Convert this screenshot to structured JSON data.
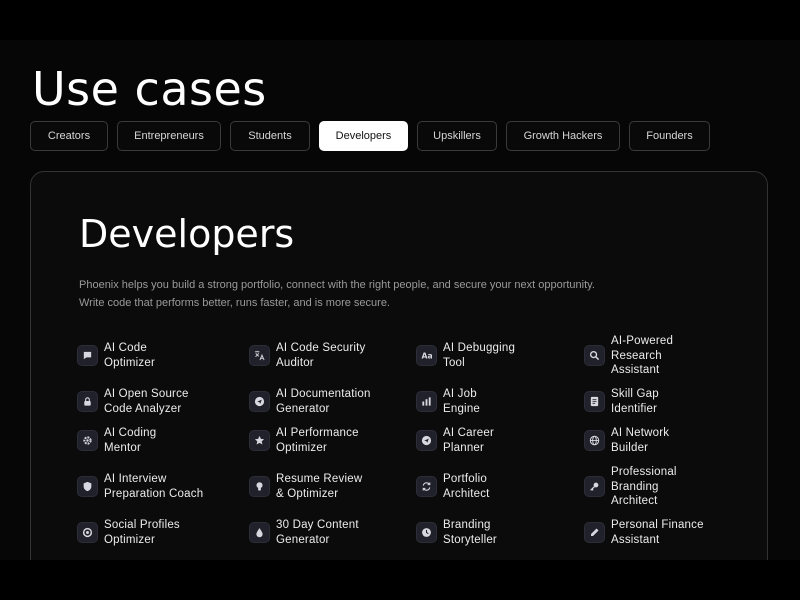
{
  "header": {
    "title": "Use cases"
  },
  "tabs": [
    {
      "label": "Creators",
      "active": false
    },
    {
      "label": "Entrepreneurs",
      "active": false
    },
    {
      "label": "Students",
      "active": false
    },
    {
      "label": "Developers",
      "active": true
    },
    {
      "label": "Upskillers",
      "active": false
    },
    {
      "label": "Growth Hackers",
      "active": false
    },
    {
      "label": "Founders",
      "active": false
    }
  ],
  "panel": {
    "title": "Developers",
    "description_line1": "Phoenix helps you build a strong portfolio, connect with the right people, and secure your next opportunity.",
    "description_line2": "Write code that performs better, runs faster, and is more secure."
  },
  "tools": [
    {
      "label": "AI Code\nOptimizer",
      "icon": "chat-icon"
    },
    {
      "label": "AI Code Security\nAuditor",
      "icon": "translate-icon"
    },
    {
      "label": "AI Debugging\nTool",
      "icon": "font-icon"
    },
    {
      "label": "AI-Powered\nResearch\nAssistant",
      "icon": "search-icon"
    },
    {
      "label": "AI Open Source\nCode Analyzer",
      "icon": "lock-icon"
    },
    {
      "label": "AI Documentation\nGenerator",
      "icon": "send-icon"
    },
    {
      "label": "AI Job\nEngine",
      "icon": "bar-chart-icon"
    },
    {
      "label": "Skill Gap\nIdentifier",
      "icon": "document-icon"
    },
    {
      "label": "AI Coding\nMentor",
      "icon": "gear-icon"
    },
    {
      "label": "AI Performance\nOptimizer",
      "icon": "star-icon"
    },
    {
      "label": "AI Career\nPlanner",
      "icon": "send-icon"
    },
    {
      "label": "AI Network\nBuilder",
      "icon": "globe-icon"
    },
    {
      "label": "AI Interview\nPreparation Coach",
      "icon": "shield-icon"
    },
    {
      "label": "Resume Review\n& Optimizer",
      "icon": "lightbulb-icon"
    },
    {
      "label": "Portfolio\nArchitect",
      "icon": "refresh-icon"
    },
    {
      "label": "Professional\nBranding\nArchitect",
      "icon": "key-icon"
    },
    {
      "label": "Social Profiles\nOptimizer",
      "icon": "target-icon"
    },
    {
      "label": "30 Day Content\nGenerator",
      "icon": "drop-icon"
    },
    {
      "label": "Branding\nStoryteller",
      "icon": "clock-icon"
    },
    {
      "label": "Personal Finance\nAssistant",
      "icon": "pencil-icon"
    }
  ],
  "colors": {
    "background": "#000000",
    "active_tab": "#ffffff",
    "icon_bg": "#20212a"
  }
}
